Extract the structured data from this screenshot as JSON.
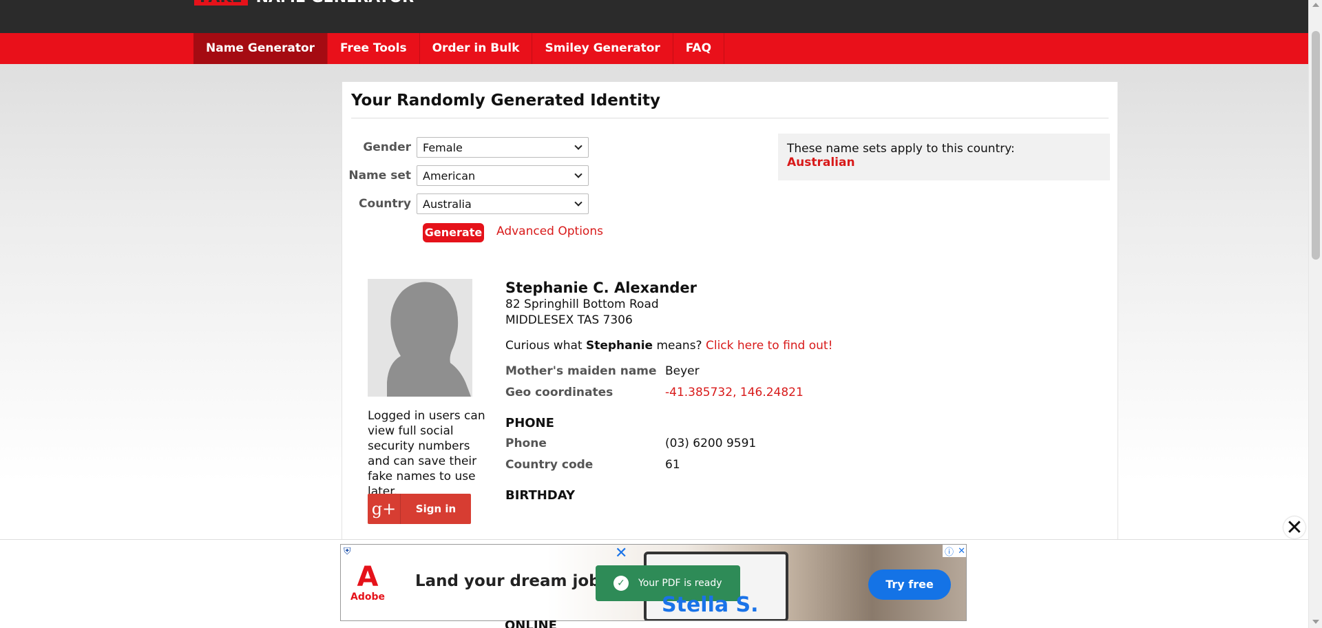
{
  "header": {
    "logo_box": "FAKE",
    "logo_text": "NAME GENERATOR"
  },
  "nav": {
    "items": [
      {
        "label": "Name Generator",
        "active": true
      },
      {
        "label": "Free Tools"
      },
      {
        "label": "Order in Bulk"
      },
      {
        "label": "Smiley Generator"
      },
      {
        "label": "FAQ"
      }
    ]
  },
  "main": {
    "title": "Your Randomly Generated Identity",
    "form": {
      "gender_label": "Gender",
      "gender_value": "Female",
      "nameset_label": "Name set",
      "nameset_value": "American",
      "country_label": "Country",
      "country_value": "Australia",
      "generate_label": "Generate",
      "advanced_label": "Advanced Options"
    },
    "country_box": {
      "text": "These name sets apply to this country:",
      "value": "Australian"
    },
    "login_text": "Logged in users can view full social security numbers and can save their fake names to use later.",
    "signin": {
      "icon_text": "g+",
      "label": "Sign in"
    },
    "identity": {
      "name": "Stephanie C. Alexander",
      "address_line1": "82 Springhill Bottom Road",
      "address_line2": "MIDDLESEX TAS 7306",
      "curious_prefix": "Curious what ",
      "curious_name": "Stephanie",
      "curious_suffix": " means? ",
      "curious_link": "Click here to find out!",
      "maiden_label": "Mother's maiden name",
      "maiden_value": "Beyer",
      "geo_label": "Geo coordinates",
      "geo_value": "-41.385732, 146.24821",
      "phone_section": "PHONE",
      "phone_label": "Phone",
      "phone_value": "(03) 6200 9591",
      "cc_label": "Country code",
      "cc_value": "61",
      "birthday_section": "BIRTHDAY",
      "online_section": "ONLINE"
    }
  },
  "ad": {
    "brand": "Adobe",
    "headline": "Land your dream job.",
    "toast": "Your PDF is ready",
    "stella": "Stella S.",
    "cta": "Try free",
    "close_glyph": "✕"
  },
  "colors": {
    "brand_red": "#e9101a",
    "nav_active": "#a50b12",
    "header_dark": "#2b2b2b",
    "link_red": "#d81a1a"
  }
}
